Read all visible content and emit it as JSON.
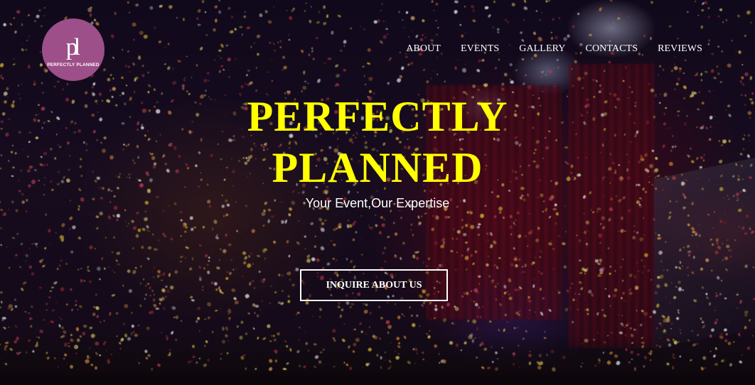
{
  "brand": {
    "logo_mark": "pl",
    "logo_text": "PERFECTLY PLANNED",
    "logo_color": "#9c4f88"
  },
  "nav": {
    "items": [
      {
        "label": "ABOUT"
      },
      {
        "label": "EVENTS"
      },
      {
        "label": "GALLERY"
      },
      {
        "label": "CONTACTS"
      },
      {
        "label": "REVIEWS"
      }
    ]
  },
  "hero": {
    "title_line1": "PERFECTLY",
    "title_line2": "PLANNED",
    "title_color": "#ffff00",
    "subtitle": "Your Event,Our Expertise",
    "cta_label": "INQUIRE ABOUT US",
    "background_description_icon": "concert-confetti-image"
  }
}
